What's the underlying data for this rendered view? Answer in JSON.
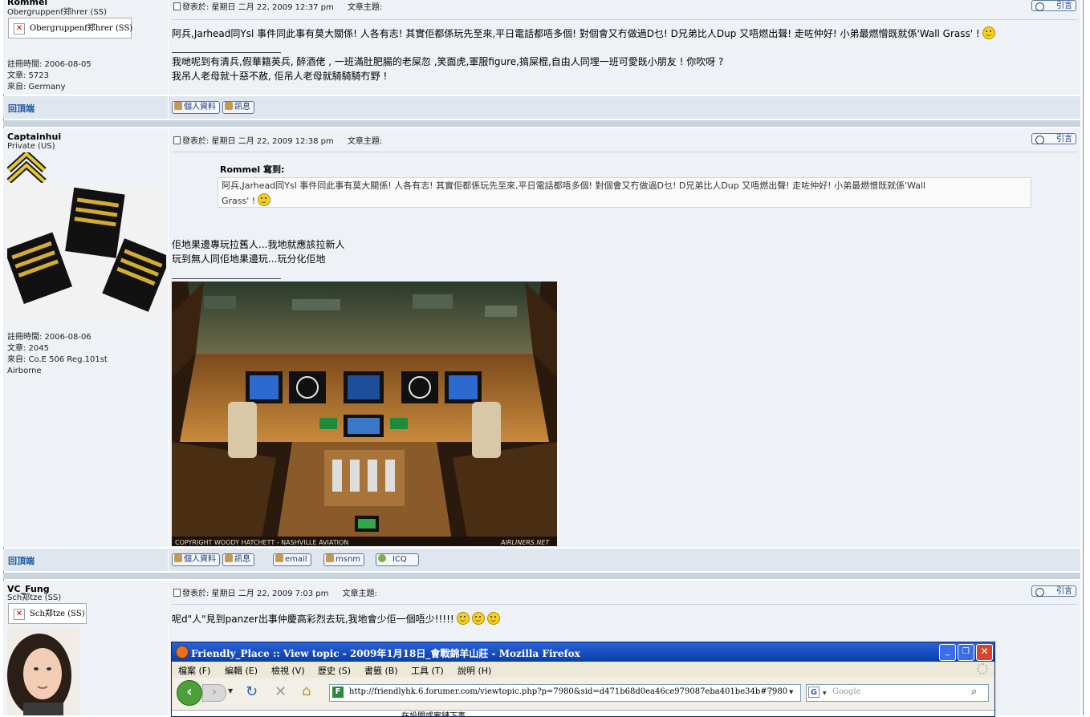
{
  "common": {
    "posted_prefix": "發表於: 星期日 二月 22, 2009",
    "subject_label": "文章主題:",
    "quote_label": "引言",
    "back_to_top": "回頂端",
    "profile_label": "個人資料",
    "pm_label": "訊息",
    "email_label": "email",
    "msnm_label": "msnm",
    "icq_label": "ICQ"
  },
  "posts": [
    {
      "author": "Rommel",
      "rank": "Obergruppenf郑hrer (SS)",
      "rank_badge": "Obergruppenf郑hrer (SS)",
      "joined": "註冊時間: 2006-08-05",
      "post_count": "文章: 5723",
      "location": "來自: Germany",
      "posted_time": "12:37 pm",
      "text_line_1": "阿兵,Jarhead同Ysl 事件同此事有莫大關係! 人各有志! 其實佢都係玩先至來,平日電話都唔多個! 對個會又冇做過D乜! D兄弟比人Dup 又唔燃出聲! 走咗仲好! 小弟最燃憎既就係'Wall Grass' !",
      "signature_1": "我哋呢到有清兵,假華籍英兵, 醉酒佬 , 一班滿肚肥腸的老屎忽 ,笑面虎,軍服figure,搞屎棍,自由人同埋一班可愛既小朋友 ! 你吹呀 ?",
      "signature_2": "我吊人老母就十惡不赦, 佢吊人老母就騎騎騎冇野 !"
    },
    {
      "author": "Captainhui",
      "rank": "Private (US)",
      "joined": "註冊時間: 2006-08-06",
      "post_count": "文章: 2045",
      "location": "來自: Co.E 506 Reg.101st Airborne",
      "posted_time": "12:38 pm",
      "quote_author": "Rommel 寫到:",
      "quote_text_1": "阿兵,Jarhead同Ysl 事件同此事有莫大關係! 人各有志! 其實佢都係玩先至來,平日電話都唔多個! 對個會又冇做過D乜! D兄弟比人Dup 又唔燃出聲! 走咗仲好! 小弟最燃憎既就係'Wall",
      "quote_text_2": "Grass' !",
      "reply_1": "佢地果邊專玩拉舊人...我地就應該拉新人",
      "reply_2": "玩到無人同佢地果邊玩...玩分化佢地",
      "sig_image_caption": "COPYRIGHT WOODY HATCHETT - NASHVILLE AVIATION",
      "sig_image_site": "AIRLINERS.NET"
    },
    {
      "author": "VC_Fung",
      "rank": "Sch郑tze (SS)",
      "rank_badge": "Sch郑tze (SS)",
      "posted_time": "7:03 pm",
      "text_line_1": "呢d\"人\"見到panzer出事仲慶高彩烈去玩,我地會少佢一個唔少!!!!!"
    }
  ],
  "browser": {
    "title": "Friendly_Place :: View topic - 2009年1月18日_會戰錦羊山莊 - Mozilla Firefox",
    "menu": [
      "檔案 (F)",
      "編輯 (E)",
      "檢視 (V)",
      "歷史 (S)",
      "書籤 (B)",
      "工具 (T)",
      "說明 (H)"
    ],
    "url": "http://friendlyhk.6.forumer.com/viewtopic.php?p=7980&sid=d471b68d0ea46ce979087eba401be34b#7980",
    "search_placeholder": "Google",
    "search_engine_letter": "G",
    "site_icon_letter": "F",
    "content_peek": "在設問或案鏈下事"
  }
}
